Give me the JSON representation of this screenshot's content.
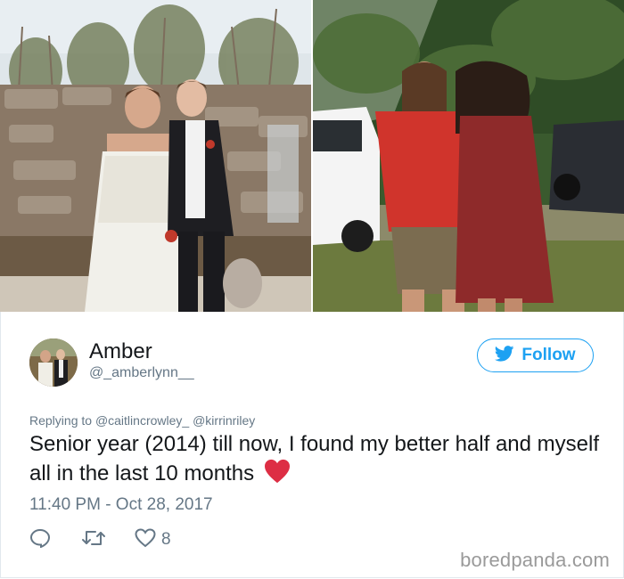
{
  "tweet": {
    "author_name": "Amber",
    "author_handle": "@_amberlynn__",
    "follow_label": "Follow",
    "replying_prefix": "Replying to",
    "replying_to": [
      "@caitlincrowley_",
      "@kirrinriley"
    ],
    "text": "Senior year (2014) till now, I found my better half and myself all in the last 10 months",
    "timestamp": "11:40 PM - Oct 28, 2017",
    "like_count": "8"
  },
  "watermark": "boredpanda.com",
  "colors": {
    "accent": "#1da1f2",
    "secondary_text": "#657786",
    "primary_text": "#14171a",
    "heart": "#e0245e"
  },
  "icons": {
    "follow": "twitter-bird-icon",
    "reply": "reply-icon",
    "retweet": "retweet-icon",
    "like": "like-heart-icon"
  }
}
